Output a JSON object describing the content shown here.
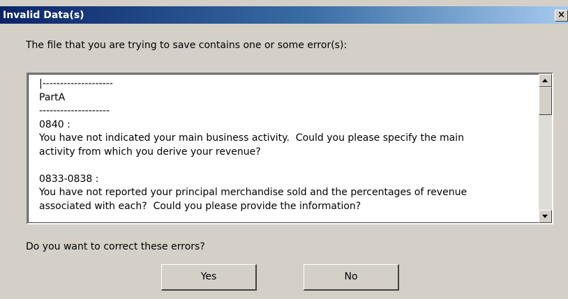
{
  "window": {
    "title": "Invalid Data(s)",
    "close_glyph": "×",
    "close_icon": "close-icon"
  },
  "prompt": "The file that you are trying to save contains one or some error(s):",
  "messages": [
    "|--------------------",
    "PartA",
    "--------------------",
    "0840 :",
    "You have not indicated your main business activity.  Could you please specify the main",
    "activity from which you derive your revenue?",
    "",
    "0833-0838 :",
    "You have not reported your principal merchandise sold and the percentages of revenue",
    "associated with each?  Could you please provide the information?"
  ],
  "question": "Do you want to correct these errors?",
  "buttons": {
    "yes": "Yes",
    "no": "No"
  },
  "colors": {
    "titlebar_start": "#0a246a",
    "titlebar_end": "#a6caf0",
    "dialog_face": "#d4d0c8"
  }
}
